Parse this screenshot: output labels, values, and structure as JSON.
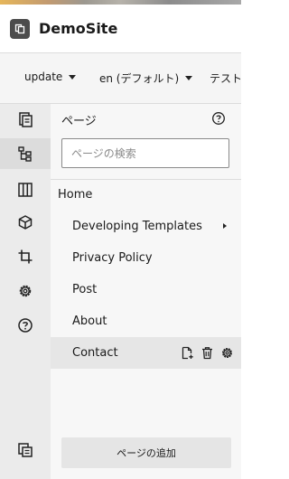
{
  "app": {
    "title": "DemoSite"
  },
  "toolbar": {
    "branch": "update",
    "language": "en (デフォルト)",
    "mode": "テスト"
  },
  "rail": {
    "icons": [
      "pages-icon",
      "sitemap-icon",
      "columns-icon",
      "cube-icon",
      "crop-icon",
      "settings-icon",
      "help-icon",
      "copy-icon"
    ]
  },
  "panel": {
    "heading": "ページ",
    "search_placeholder": "ページの検索",
    "tree": {
      "root": "Home",
      "children": [
        "Developing Templates",
        "Privacy Policy",
        "Post",
        "About",
        "Contact"
      ],
      "selected": "Contact"
    },
    "add_button": "ページの追加"
  },
  "colors": {
    "rail_bg": "#ebebeb",
    "panel_bg": "#f7f7f7",
    "selected_bg": "#e6e6e6"
  }
}
